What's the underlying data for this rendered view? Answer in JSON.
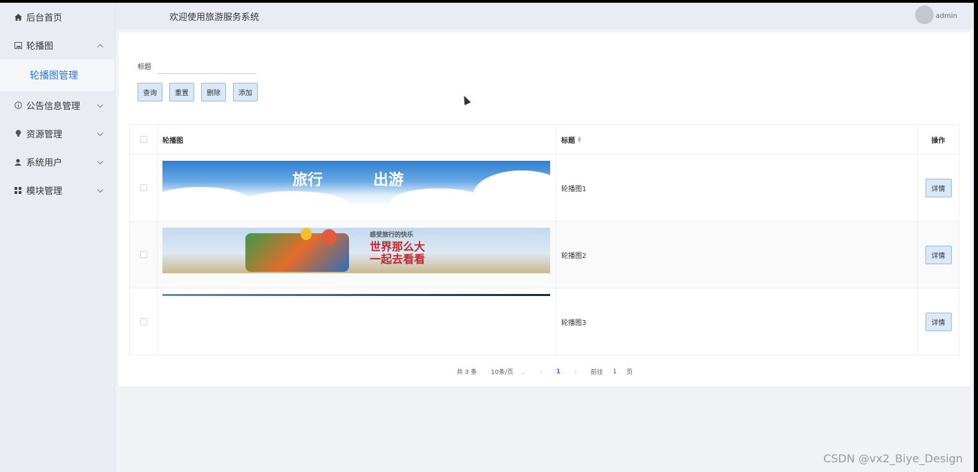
{
  "header": {
    "title": "欢迎使用旅游服务系统",
    "user": "admin"
  },
  "sidebar": {
    "items": [
      {
        "label": "后台首页",
        "icon": "home-icon"
      },
      {
        "label": "轮播图",
        "icon": "image-icon",
        "expanded": true
      },
      {
        "label": "轮播图管理",
        "active": true
      },
      {
        "label": "公告信息管理",
        "icon": "info-icon"
      },
      {
        "label": "资源管理",
        "icon": "bulb-icon"
      },
      {
        "label": "系统用户",
        "icon": "user-icon"
      },
      {
        "label": "模块管理",
        "icon": "grid-icon"
      }
    ]
  },
  "search": {
    "label": "标题",
    "value": ""
  },
  "buttons": {
    "query": "查询",
    "reset": "重置",
    "delete": "删除",
    "add": "添加"
  },
  "table": {
    "headers": {
      "image": "轮播图",
      "title": "标题",
      "actions": "操作"
    },
    "rows": [
      {
        "title": "轮播图1",
        "action": "详情",
        "banner_text": "旅行",
        "banner_text2": "出游"
      },
      {
        "title": "轮播图2",
        "action": "详情",
        "banner_line1": "感受旅行的快乐",
        "banner_line2": "世界那么大",
        "banner_line3": "一起去看看"
      },
      {
        "title": "轮播图3",
        "action": "详情"
      }
    ]
  },
  "pagination": {
    "total": "共 3 条",
    "page_size": "10条/页",
    "current_page": "1",
    "goto_label": "前往",
    "goto_value": "1",
    "page_unit": "页"
  },
  "watermark": "CSDN @vx2_Biye_Design"
}
